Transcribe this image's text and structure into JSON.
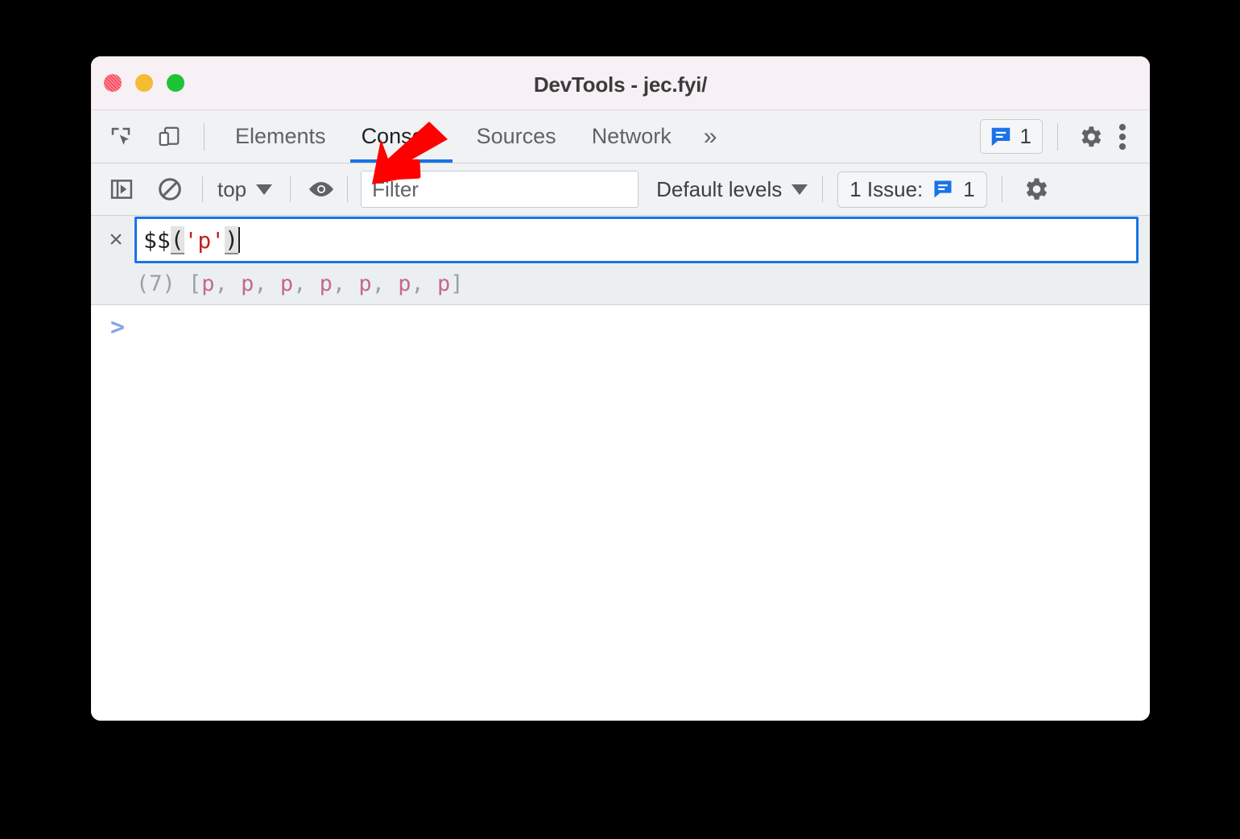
{
  "window": {
    "title": "DevTools - jec.fyi/",
    "traffic_lights": [
      {
        "name": "close",
        "color": "#fb4f62"
      },
      {
        "name": "minimize",
        "color": "#f5bb33"
      },
      {
        "name": "maximize",
        "color": "#1ec337"
      }
    ]
  },
  "tabbar": {
    "inspect_icon": "inspect-element-icon",
    "device_icon": "device-toolbar-icon",
    "tabs": [
      {
        "label": "Elements",
        "active": false
      },
      {
        "label": "Console",
        "active": true
      },
      {
        "label": "Sources",
        "active": false
      },
      {
        "label": "Network",
        "active": false
      }
    ],
    "more_tabs": "»",
    "issues_count": "1",
    "issues_icon": "issues-message-icon",
    "settings_icon": "gear-icon",
    "menu_icon": "kebab-menu-icon",
    "active_tab_accent": "#1a73e8"
  },
  "console_toolbar": {
    "sidebar_toggle_icon": "console-sidebar-toggle-icon",
    "clear_console_icon": "clear-console-icon",
    "context": "top",
    "context_caret": "▼",
    "eye_icon": "live-expression-eye-icon",
    "filter_placeholder": "Filter",
    "filter_value": "",
    "levels": "Default levels",
    "levels_caret": "▼",
    "issue_label": "1 Issue:",
    "issue_icon": "issues-message-icon",
    "issue_count": "1",
    "settings_icon": "gear-icon"
  },
  "console_input": {
    "close_label": "×",
    "tokens": [
      {
        "text": "$$",
        "kind": "plain"
      },
      {
        "text": "(",
        "kind": "bracket"
      },
      {
        "text": "'p'",
        "kind": "string"
      },
      {
        "text": ")",
        "kind": "bracket"
      }
    ],
    "full_text": "$$('p')"
  },
  "console_result": {
    "count": "(7)",
    "open": " [",
    "nodes": [
      "p",
      "p",
      "p",
      "p",
      "p",
      "p",
      "p"
    ],
    "separator": ", ",
    "close": "]",
    "node_color": "#c26a8f"
  },
  "console_body": {
    "prompt": ">"
  },
  "annotation": {
    "arrow_color": "#ff0000",
    "arrow_name": "red-pointer-arrow",
    "points_at": "Console"
  }
}
